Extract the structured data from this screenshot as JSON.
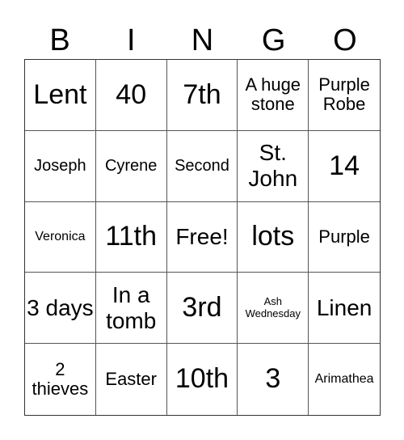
{
  "header": [
    "B",
    "I",
    "N",
    "G",
    "O"
  ],
  "cells": [
    {
      "text": "Lent",
      "size": "xl"
    },
    {
      "text": "40",
      "size": "xl"
    },
    {
      "text": "7th",
      "size": "xl"
    },
    {
      "text": "A huge stone",
      "size": "m"
    },
    {
      "text": "Purple Robe",
      "size": "m"
    },
    {
      "text": "Joseph",
      "size": "s"
    },
    {
      "text": "Cyrene",
      "size": "s"
    },
    {
      "text": "Second",
      "size": "s"
    },
    {
      "text": "St. John",
      "size": "l"
    },
    {
      "text": "14",
      "size": "xl"
    },
    {
      "text": "Veronica",
      "size": "ss"
    },
    {
      "text": "11th",
      "size": "xl"
    },
    {
      "text": "Free!",
      "size": "l"
    },
    {
      "text": "lots",
      "size": "xl"
    },
    {
      "text": "Purple",
      "size": "m"
    },
    {
      "text": "3 days",
      "size": "l"
    },
    {
      "text": "In a tomb",
      "size": "l"
    },
    {
      "text": "3rd",
      "size": "xl"
    },
    {
      "text": "Ash Wednesday",
      "size": "xs"
    },
    {
      "text": "Linen",
      "size": "l"
    },
    {
      "text": "2 thieves",
      "size": "m"
    },
    {
      "text": "Easter",
      "size": "m"
    },
    {
      "text": "10th",
      "size": "xl"
    },
    {
      "text": "3",
      "size": "xl"
    },
    {
      "text": "Arimathea",
      "size": "ss"
    }
  ]
}
